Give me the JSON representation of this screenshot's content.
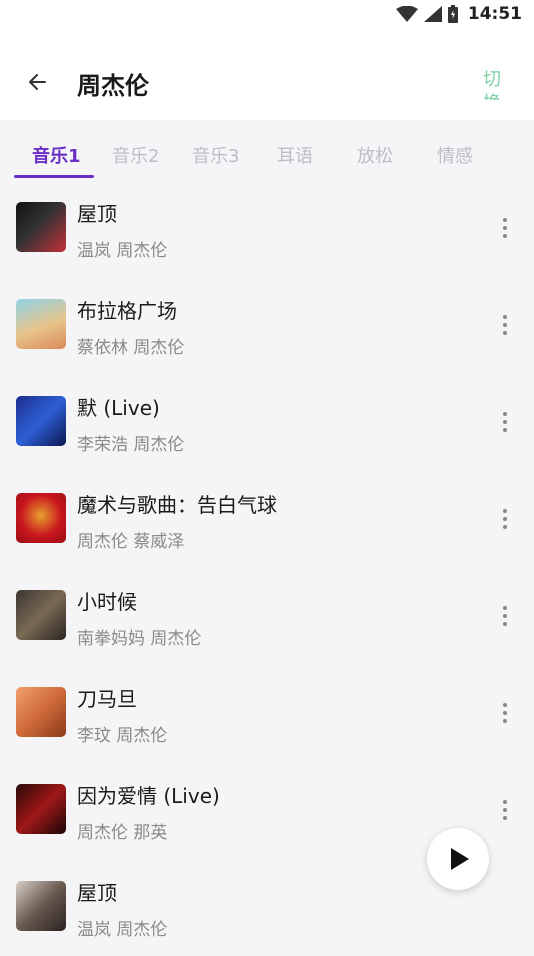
{
  "status_bar": {
    "time": "14:51"
  },
  "header": {
    "title": "周杰伦",
    "switch_label": "切换"
  },
  "tabs": [
    {
      "label": "音乐1",
      "active": true
    },
    {
      "label": "音乐2",
      "active": false
    },
    {
      "label": "音乐3",
      "active": false
    },
    {
      "label": "耳语",
      "active": false
    },
    {
      "label": "放松",
      "active": false
    },
    {
      "label": "情感",
      "active": false
    }
  ],
  "songs": [
    {
      "title": "屋顶",
      "artists": "温岚 周杰伦"
    },
    {
      "title": "布拉格广场",
      "artists": "蔡依林 周杰伦"
    },
    {
      "title": "默 (Live)",
      "artists": "李荣浩 周杰伦"
    },
    {
      "title": "魔术与歌曲：告白气球",
      "artists": "周杰伦 蔡威泽"
    },
    {
      "title": "小时候",
      "artists": "南拳妈妈 周杰伦"
    },
    {
      "title": "刀马旦",
      "artists": "李玟 周杰伦"
    },
    {
      "title": "因为爱情 (Live)",
      "artists": "周杰伦 那英"
    },
    {
      "title": "屋顶",
      "artists": "温岚 周杰伦"
    }
  ],
  "colors": {
    "accent": "#6a2fc6",
    "switch": "#7fd0a8",
    "background": "#f5f5f7"
  },
  "icons": {
    "back": "arrow-left-icon",
    "more": "more-vertical-icon",
    "play": "play-icon",
    "wifi": "wifi-icon",
    "signal": "signal-icon",
    "battery": "battery-icon"
  }
}
